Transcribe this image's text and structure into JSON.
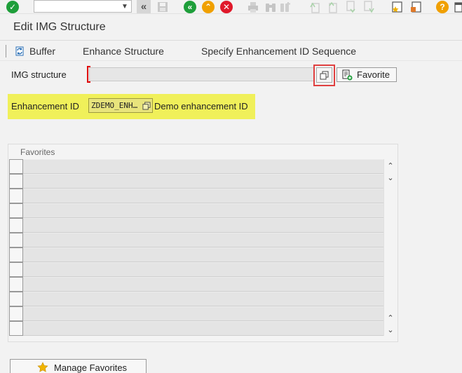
{
  "toolbar": {
    "enter_icon": "green-check-icon",
    "command_field": {
      "value": ""
    },
    "icons": [
      "green-check-icon",
      "chevron-down-icon",
      "double-left-icon",
      "save-icon",
      "back-icon",
      "exit-icon",
      "cancel-icon",
      "print-icon",
      "find-icon",
      "find-next-icon",
      "first-page-icon",
      "previous-page-icon",
      "next-page-icon",
      "last-page-icon",
      "create-session-icon",
      "shortcut-icon",
      "help-icon"
    ]
  },
  "page": {
    "title": "Edit IMG Structure"
  },
  "app_toolbar": {
    "buffer_label": "Buffer",
    "enhance_structure_label": "Enhance Structure",
    "enhancement_sequence_label": "Specify Enhancement ID Sequence"
  },
  "form": {
    "img_structure_label": "IMG structure",
    "img_structure_value": "",
    "favorite_button_label": "Favorite",
    "enhancement_id_label": "Enhancement ID",
    "enhancement_id_value": "ZDEMO_ENH…",
    "enhancement_description": "Demo enhancement ID"
  },
  "favorites": {
    "title": "Favorites",
    "row_count": 12,
    "rows": [
      "",
      "",
      "",
      "",
      "",
      "",
      "",
      "",
      "",
      "",
      "",
      ""
    ]
  },
  "manage_favorites_label": "Manage Favorites",
  "colors": {
    "highlight": "#f0f05a",
    "accent_green": "#1e9e3a",
    "accent_orange": "#f0a000",
    "accent_red": "#e0182a",
    "required": "#e00000"
  }
}
